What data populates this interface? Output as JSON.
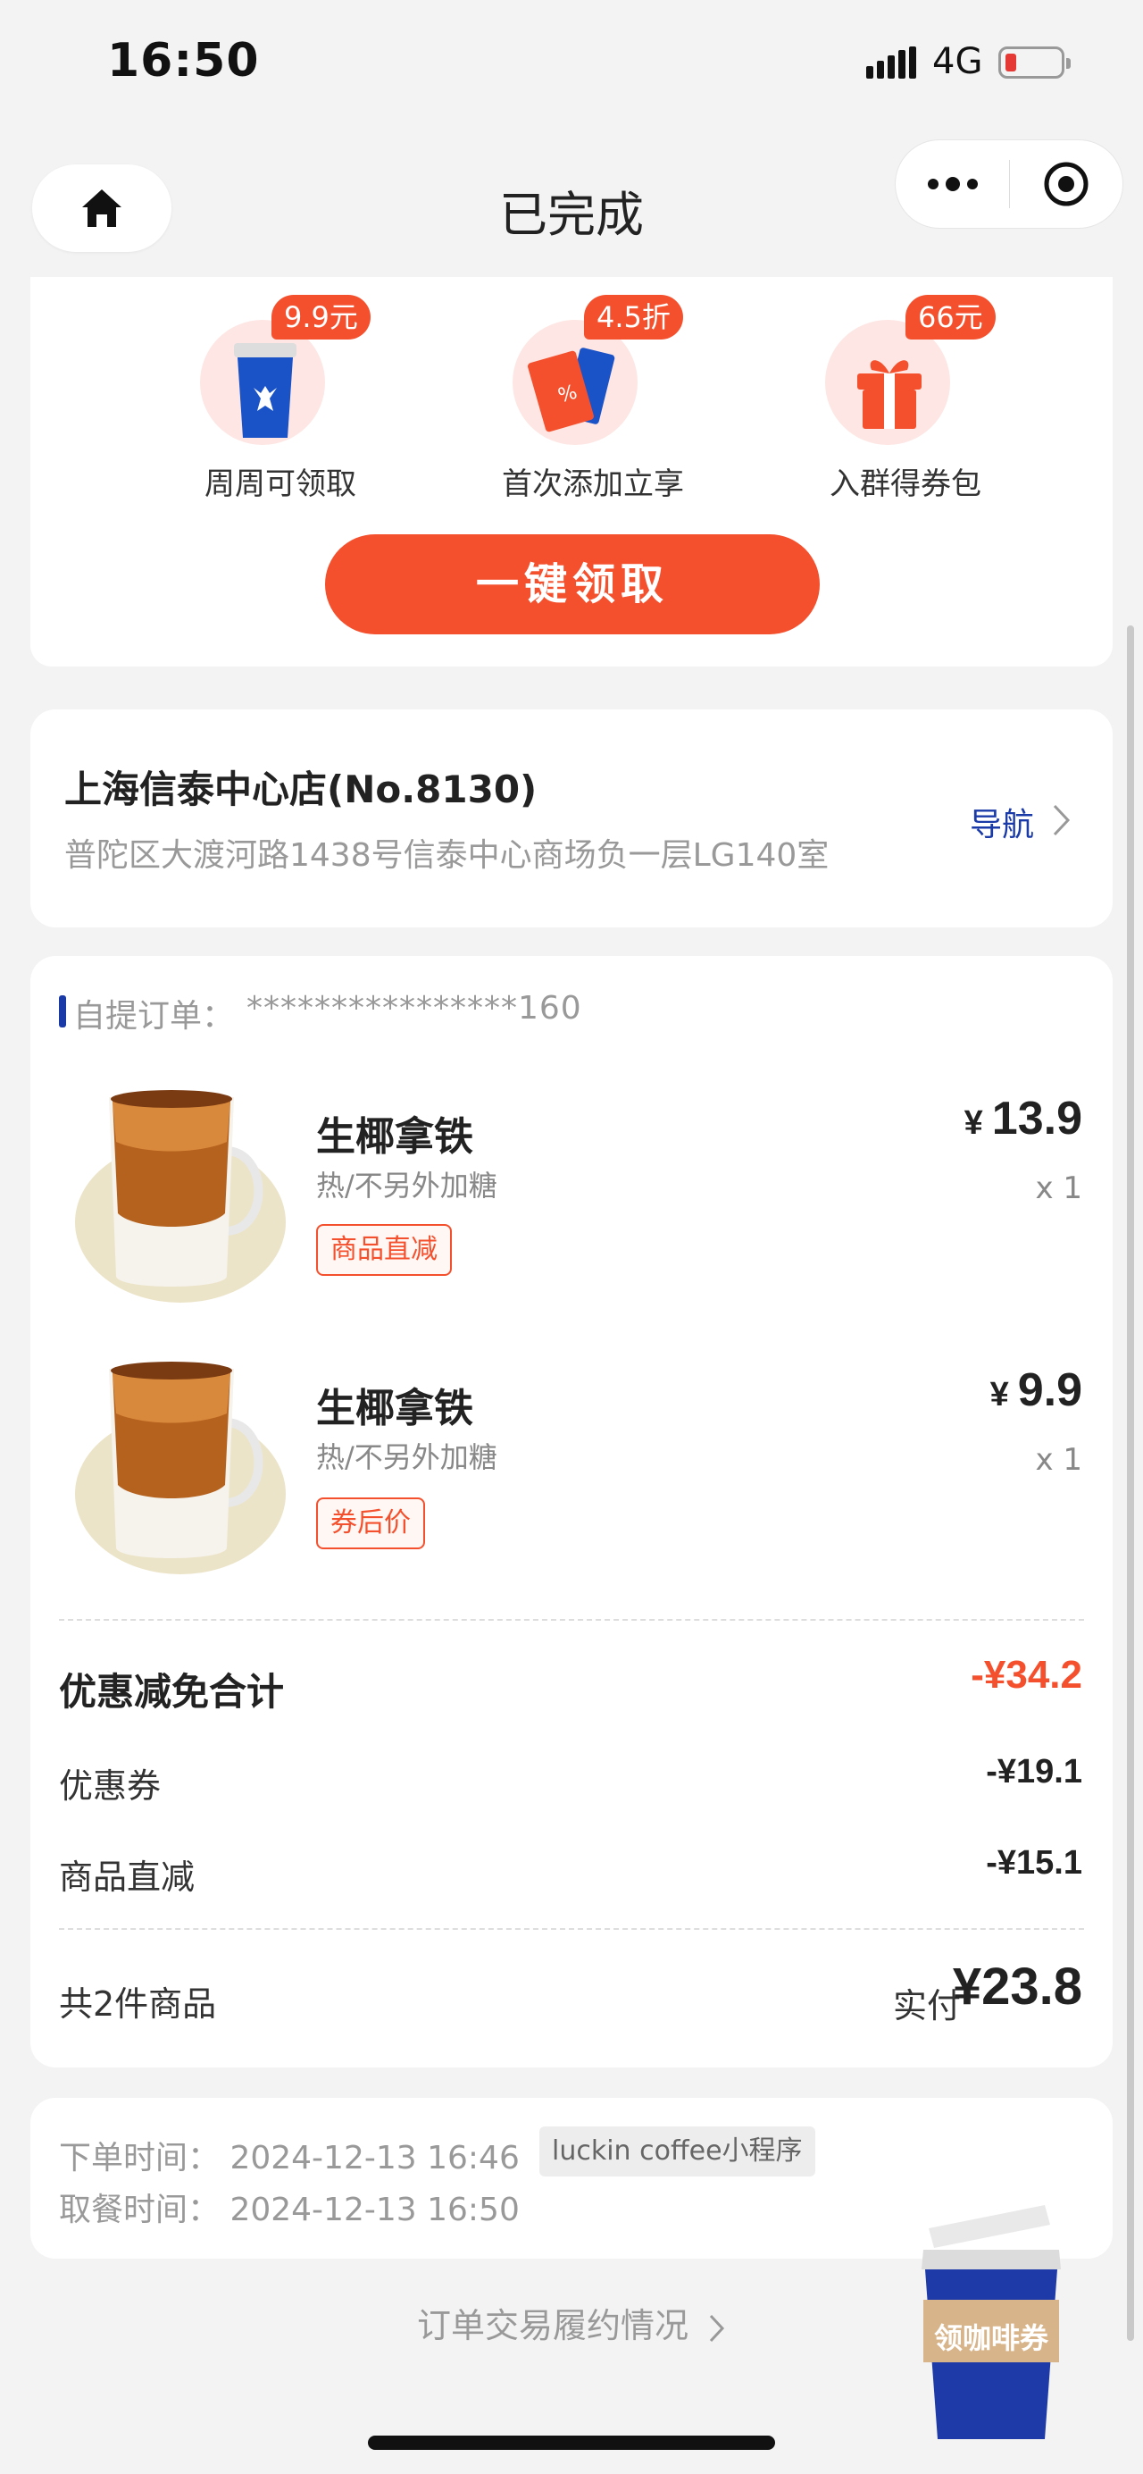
{
  "status_bar": {
    "time": "16:50",
    "network": "4G"
  },
  "nav": {
    "title": "已完成"
  },
  "promo": {
    "items": [
      {
        "badge": "9.9元",
        "label": "周周可领取",
        "icon": "cup-icon"
      },
      {
        "badge": "4.5折",
        "label": "首次添加立享",
        "icon": "ticket-icon"
      },
      {
        "badge": "66元",
        "label": "入群得券包",
        "icon": "gift-icon"
      }
    ],
    "button": "一键领取",
    "accent": "#f4502d"
  },
  "store": {
    "name": "上海信泰中心店(No.8130)",
    "address": "普陀区大渡河路1438号信泰中心商场负一层LG140室",
    "nav_label": "导航"
  },
  "order": {
    "label": "自提订单：",
    "number": "****************160",
    "items": [
      {
        "name": "生椰拿铁",
        "option": "热/不另外加糖",
        "tag": "商品直减",
        "currency": "¥",
        "price": "13.9",
        "qty": "x 1"
      },
      {
        "name": "生椰拿铁",
        "option": "热/不另外加糖",
        "tag": "券后价",
        "currency": "¥",
        "price": "9.9",
        "qty": "x 1"
      }
    ],
    "discount_title": "优惠减免合计",
    "discount_total": "-¥34.2",
    "rows": [
      {
        "label": "优惠券",
        "value": "-¥19.1"
      },
      {
        "label": "商品直减",
        "value": "-¥15.1"
      }
    ],
    "count_label": "共2件商品",
    "paid_label": "实付",
    "paid_value": "¥23.8"
  },
  "times": {
    "order_time": "下单时间：  2024-12-13 16:46",
    "pickup_time": "取餐时间：  2024-12-13 16:50",
    "source": "luckin coffee小程序"
  },
  "footer_link": "订单交易履约情况",
  "float_widget": {
    "label": "领咖啡券"
  },
  "colors": {
    "brand_blue": "#1a3aa8",
    "accent": "#f4502d"
  }
}
